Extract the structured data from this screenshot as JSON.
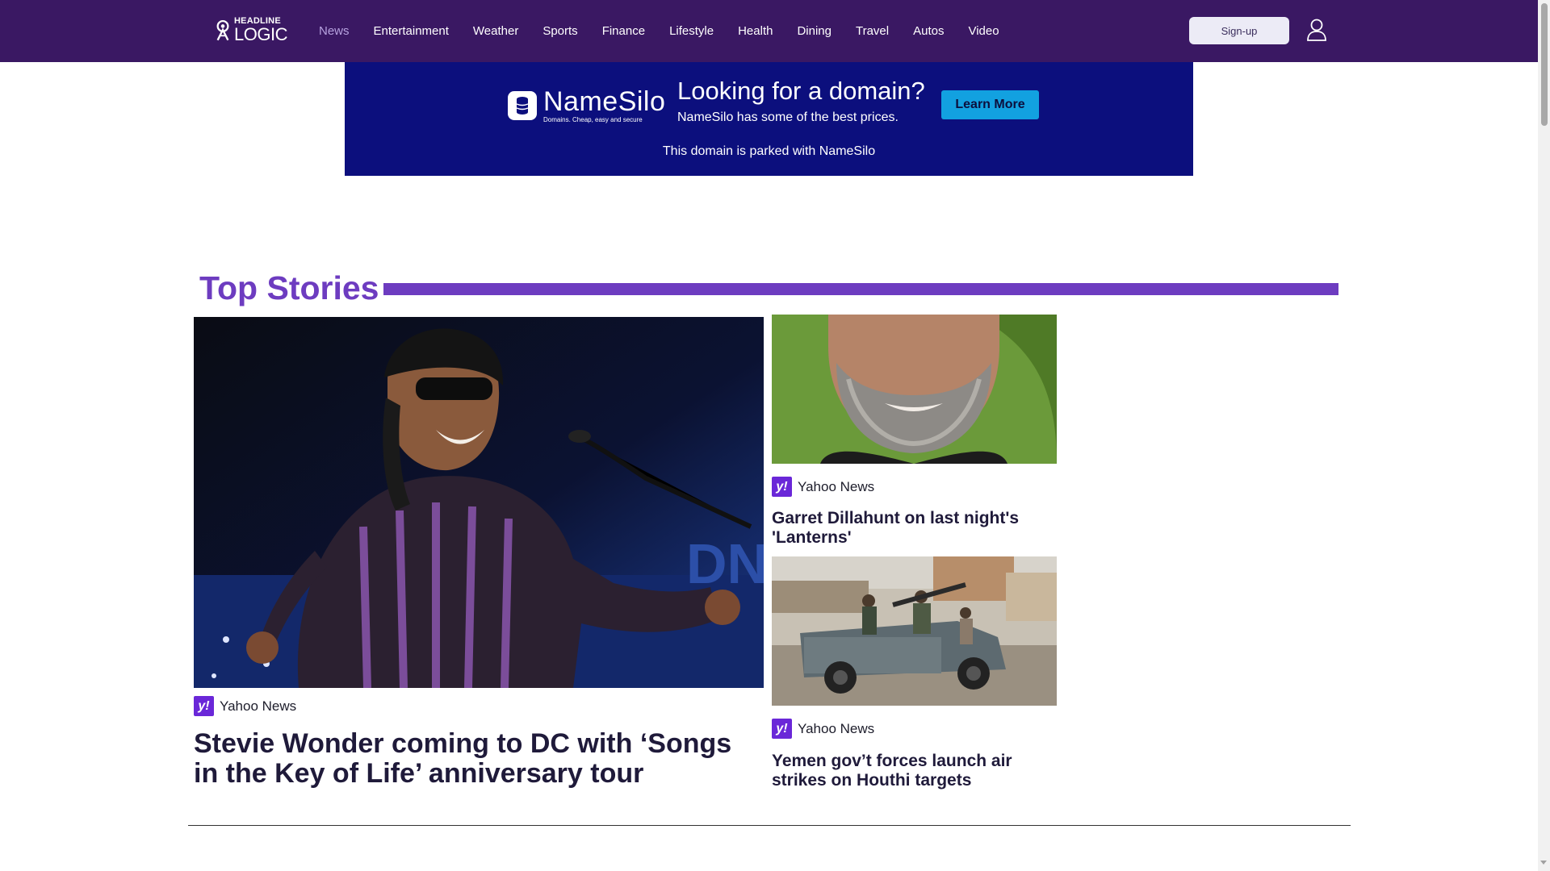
{
  "header": {
    "logo_top": "HEADLINE",
    "logo_bottom": "LOGIC",
    "nav": [
      "News",
      "Entertainment",
      "Weather",
      "Sports",
      "Finance",
      "Lifestyle",
      "Health",
      "Dining",
      "Travel",
      "Autos",
      "Video"
    ],
    "active_nav": "News",
    "signup_label": "Sign-up",
    "user_icon": "user-icon"
  },
  "banner": {
    "brand": "NameSilo",
    "tagline": "Domains. Cheap, easy and secure",
    "headline": "Looking for a domain?",
    "subtext": "NameSilo has some of the best prices.",
    "button_label": "Learn More",
    "parked_text": "This domain is parked with NameSilo",
    "colors": {
      "background": "#0c0f7d",
      "button": "#12a1e0"
    }
  },
  "top_stories": {
    "title": "Top Stories",
    "accent_color": "#6d3cc0",
    "stories": [
      {
        "source": "Yahoo News",
        "headline": "Stevie Wonder coming to DC with ‘Songs in the Key of Life’ anniversary tour"
      },
      {
        "source": "Yahoo News",
        "headline": "Garret Dillahunt on last night's 'Lanterns'"
      },
      {
        "source": "Yahoo News",
        "headline": "Yemen gov’t forces launch air strikes on Houthi targets"
      }
    ]
  },
  "icons": {
    "source_icon": "yahoo-icon",
    "source_icon_glyph": "y!"
  }
}
